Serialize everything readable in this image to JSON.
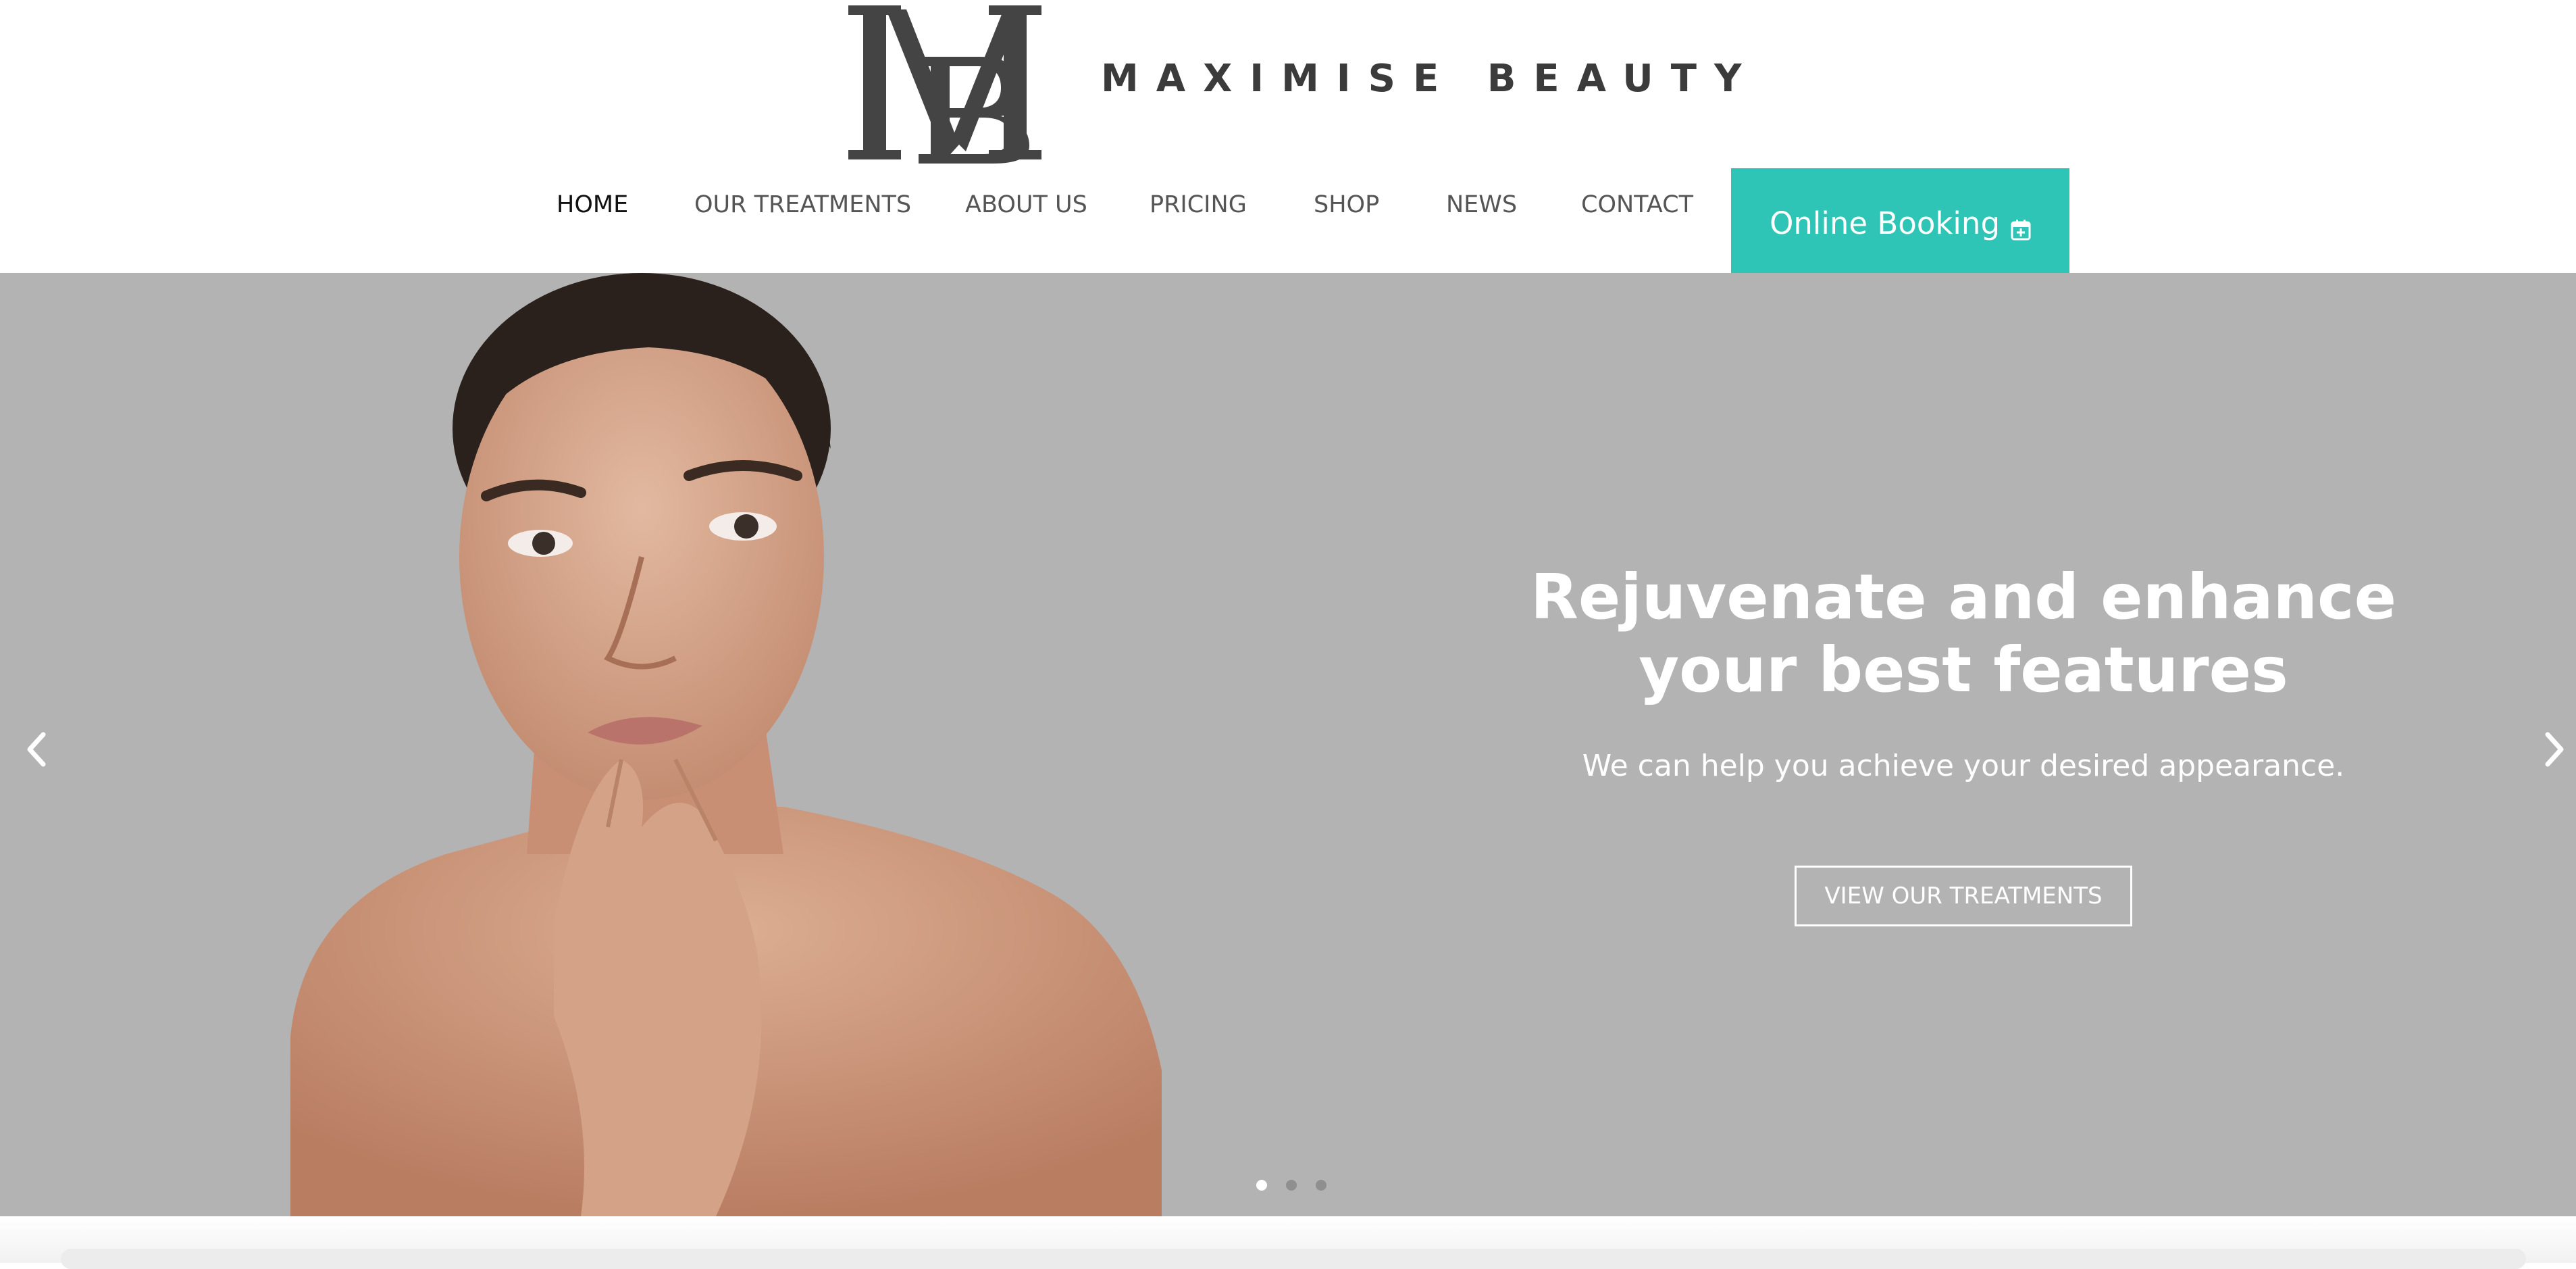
{
  "brand": {
    "name": "MAXIMISE BEAUTY",
    "monogram": "MB"
  },
  "nav": {
    "items": [
      {
        "label": "HOME",
        "active": true
      },
      {
        "label": "OUR TREATMENTS",
        "active": false
      },
      {
        "label": "ABOUT US",
        "active": false
      },
      {
        "label": "PRICING",
        "active": false
      },
      {
        "label": "SHOP",
        "active": false
      },
      {
        "label": "NEWS",
        "active": false
      },
      {
        "label": "CONTACT",
        "active": false
      }
    ],
    "booking_label": "Online Booking",
    "booking_icon": "calendar-plus-icon"
  },
  "hero": {
    "title_line1": "Rejuvenate and enhance",
    "title_line2": "your best features",
    "subtitle": "We can help you achieve your desired appearance.",
    "button_label": "VIEW OUR TREATMENTS",
    "slide_count": 3,
    "active_slide": 1
  },
  "colors": {
    "accent": "#2ec4b6",
    "hero_bg": "#b3b3b3",
    "text_dark": "#111111",
    "nav_text": "#555555"
  }
}
